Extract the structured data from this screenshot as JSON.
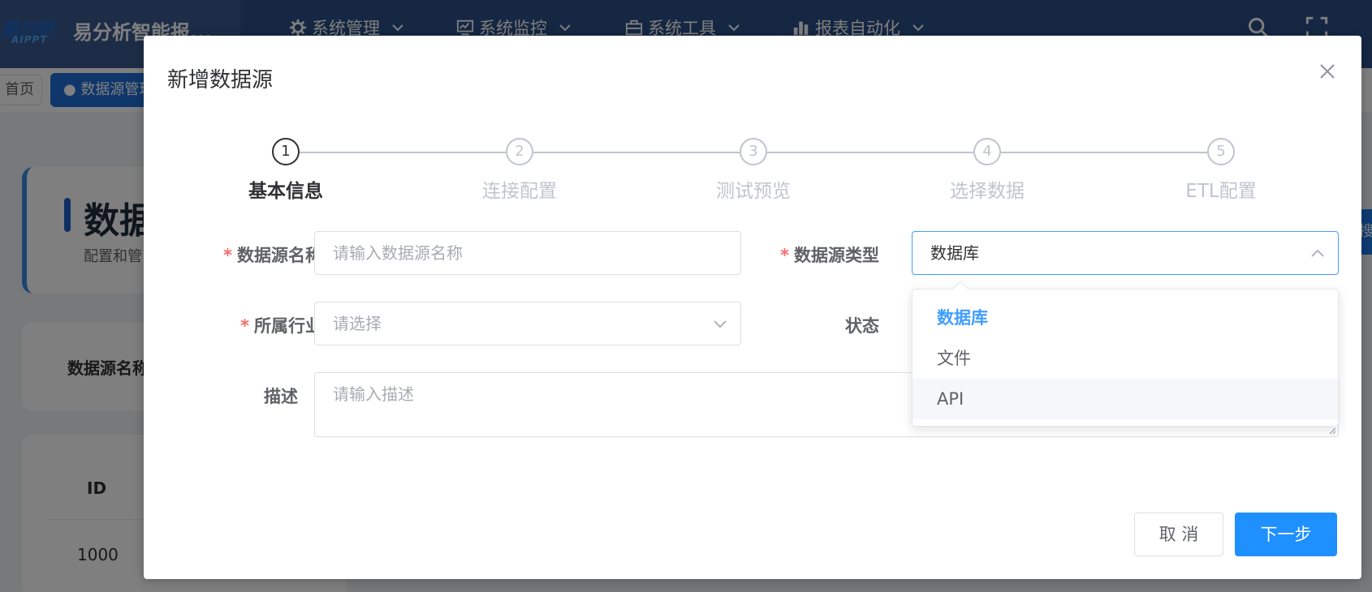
{
  "app": {
    "logo_text": "易分析",
    "logo_sub": "AIPPT",
    "title": "易分析智能报..."
  },
  "nav": [
    {
      "label": "系统管理",
      "icon": "gear-icon"
    },
    {
      "label": "系统监控",
      "icon": "monitor-icon"
    },
    {
      "label": "系统工具",
      "icon": "toolbox-icon"
    },
    {
      "label": "报表自动化",
      "icon": "bar-chart-icon"
    }
  ],
  "header_icons": [
    "search-icon",
    "fullscreen-icon"
  ],
  "tags": {
    "home": "首页",
    "active": "● 数据源管理"
  },
  "background": {
    "page_title": "数据",
    "page_subtitle": "配置和管",
    "search_label": "数据源名称",
    "table_header_id": "ID",
    "table_first_id": "1000",
    "right_button": "搜"
  },
  "dialog": {
    "title": "新增数据源",
    "steps": [
      {
        "number": "1",
        "title": "基本信息",
        "active": true
      },
      {
        "number": "2",
        "title": "连接配置",
        "active": false
      },
      {
        "number": "3",
        "title": "测试预览",
        "active": false
      },
      {
        "number": "4",
        "title": "选择数据",
        "active": false
      },
      {
        "number": "5",
        "title": "ETL配置",
        "active": false
      }
    ],
    "form": {
      "name_label": "数据源名称",
      "name_placeholder": "请输入数据源名称",
      "type_label": "数据源类型",
      "type_value": "数据库",
      "industry_label": "所属行业",
      "industry_placeholder": "请选择",
      "status_label": "状态",
      "desc_label": "描述",
      "desc_placeholder": "请输入描述"
    },
    "type_options": [
      {
        "label": "数据库",
        "selected": true
      },
      {
        "label": "文件",
        "selected": false
      },
      {
        "label": "API",
        "selected": false
      }
    ],
    "buttons": {
      "cancel": "取 消",
      "next": "下一步"
    }
  },
  "colors": {
    "primary": "#1e90ff",
    "required": "#f56c6c",
    "header": "#2b4e86"
  }
}
